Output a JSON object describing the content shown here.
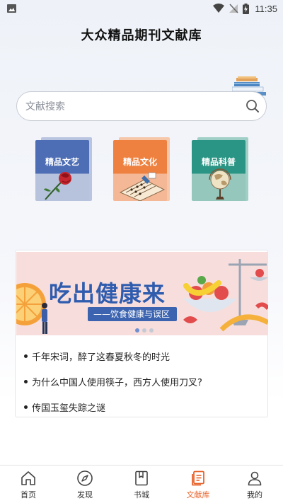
{
  "status_bar": {
    "time": "11:35"
  },
  "header": {
    "title": "大众精品期刊文献库"
  },
  "search": {
    "placeholder": "文献搜索"
  },
  "categories": [
    {
      "label": "精品文艺",
      "color": "#4d6db4"
    },
    {
      "label": "精品文化",
      "color": "#ef8140"
    },
    {
      "label": "精品科普",
      "color": "#2a9584"
    }
  ],
  "banner": {
    "title": "吃出健康来",
    "subtitle": "——饮食健康与误区",
    "slide_count": 3,
    "active_slide": 1
  },
  "articles": [
    "千年宋词，醉了这春夏秋冬的时光",
    "为什么中国人使用筷子，西方人使用刀叉?",
    "传国玉玺失踪之谜"
  ],
  "tabs": [
    {
      "label": "首页",
      "icon": "home-icon"
    },
    {
      "label": "发现",
      "icon": "compass-icon"
    },
    {
      "label": "书城",
      "icon": "bookmark-book-icon"
    },
    {
      "label": "文献库",
      "icon": "document-library-icon",
      "active": true
    },
    {
      "label": "我的",
      "icon": "user-icon"
    }
  ],
  "colors": {
    "accent": "#e8632c",
    "banner_blue": "#2f5cae"
  }
}
